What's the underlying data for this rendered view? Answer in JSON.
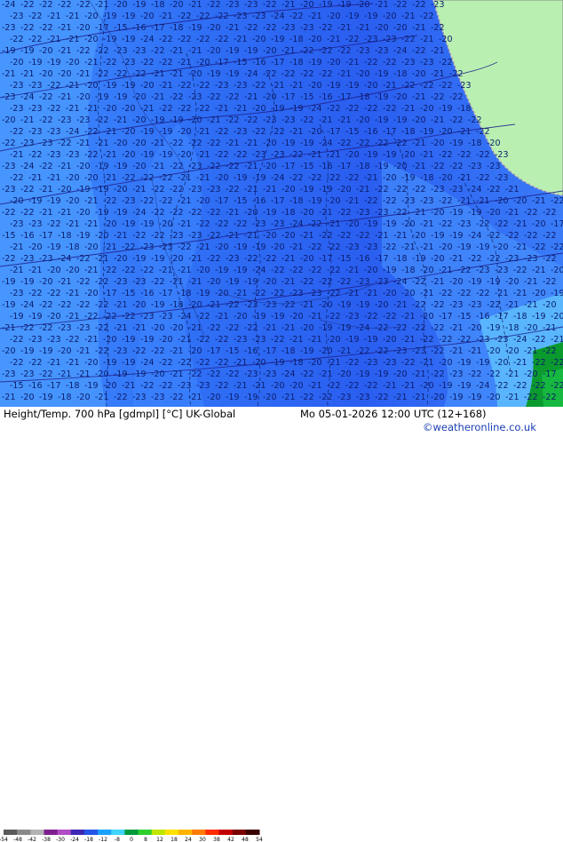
{
  "header": {
    "title_left": "Height/Temp. 700 hPa [gdmpl] [°C] UK-Global",
    "title_right": "Mo 05-01-2026 12:00 UTC (12+168)"
  },
  "credit": "©weatheronline.co.uk",
  "legend": {
    "labels": [
      "-54",
      "-48",
      "-42",
      "-38",
      "-30",
      "-24",
      "-18",
      "-12",
      "-8",
      "0",
      "8",
      "12",
      "18",
      "24",
      "30",
      "38",
      "42",
      "48",
      "54"
    ],
    "colors": [
      "#5b5b5b",
      "#8a8a8a",
      "#b3b3b3",
      "#7d1f8f",
      "#b14cc4",
      "#3c28b4",
      "#2356e6",
      "#1aa0ff",
      "#3fd4ff",
      "#009a3a",
      "#2ed02e",
      "#bfe600",
      "#ffe100",
      "#ffb300",
      "#ff7a00",
      "#ff2a00",
      "#c20000",
      "#7a0000",
      "#3a0000"
    ]
  },
  "map": {
    "colors": {
      "deep_blue": "#2a5ef0",
      "mid_blue": "#3d86ff",
      "light_blue": "#52a6ff",
      "land": "#b9f0b2",
      "coast": "#9a9a9a",
      "green_corner": "#0b9a2e",
      "contour": "#1e1e8a",
      "isotherm": "#0a1a5a"
    },
    "temperature_labels": [
      "-24",
      "-22",
      "-22",
      "-22",
      "-22",
      "-21",
      "-20",
      "-19",
      "-18",
      "-20",
      "-21",
      "-22",
      "-23",
      "-23",
      "-22",
      "-21",
      "-20",
      "-19",
      "-19",
      "-20",
      "-21",
      "-22",
      "-22",
      "-23",
      "-23",
      "-22",
      "-21",
      "-21",
      "-20",
      "-19",
      "-19",
      "-20",
      "-21",
      "-22",
      "-22",
      "-22",
      "-23",
      "-23",
      "-24",
      "-22",
      "-21",
      "-20",
      "-19",
      "-19",
      "-20",
      "-21",
      "-22",
      "-23",
      "-22",
      "-22",
      "-21",
      "-20",
      "-17",
      "-15",
      "-16",
      "-17",
      "-18",
      "-19",
      "-20",
      "-21",
      "-22",
      "-22",
      "-23",
      "-23",
      "-22",
      "-21",
      "-21",
      "-20",
      "-20",
      "-21",
      "-22",
      "-22",
      "-22",
      "-21",
      "-21",
      "-20",
      "-19",
      "-19"
    ]
  }
}
